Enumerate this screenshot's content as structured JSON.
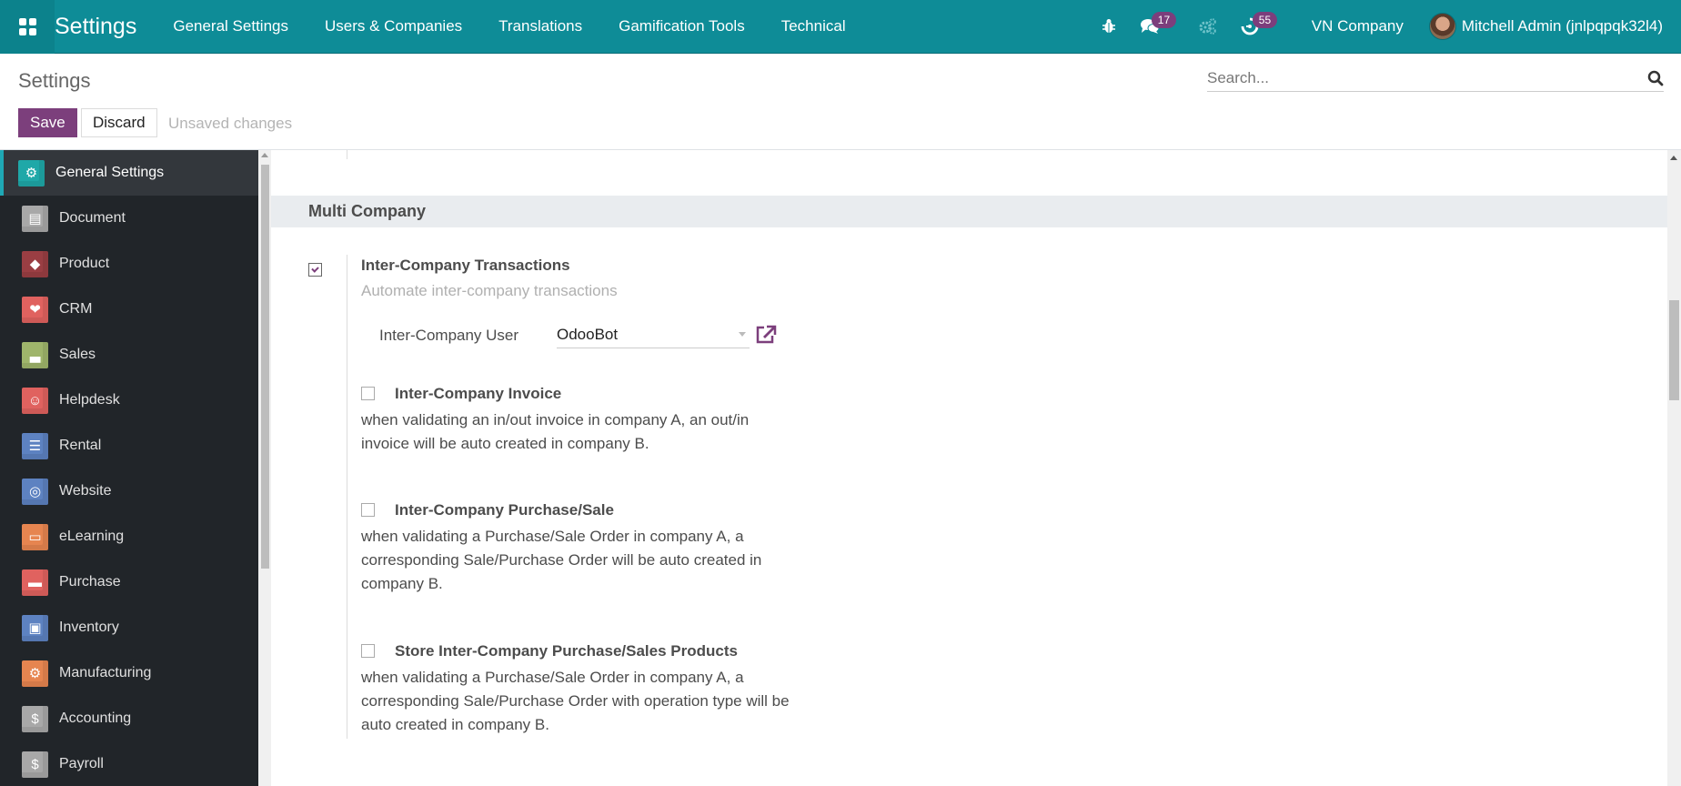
{
  "navbar": {
    "app_title": "Settings",
    "menu": [
      {
        "label": "General Settings"
      },
      {
        "label": "Users & Companies"
      },
      {
        "label": "Translations"
      },
      {
        "label": "Gamification Tools"
      },
      {
        "label": "Technical"
      }
    ],
    "icons": {
      "debug": "bug-icon",
      "messages": "chat-icon",
      "messages_count": "17",
      "settings": "gears-icon",
      "activities": "clock-icon",
      "activities_count": "55"
    },
    "company": "VN Company",
    "user": "Mitchell Admin (jnlpqpqk32l4)"
  },
  "control_panel": {
    "breadcrumb": "Settings",
    "search_placeholder": "Search...",
    "save_label": "Save",
    "discard_label": "Discard",
    "status": "Unsaved changes"
  },
  "sidebar": {
    "items": [
      {
        "label": "General Settings",
        "icon": "gear-icon",
        "color": "#1fa8a8",
        "active": true
      },
      {
        "label": "Document",
        "icon": "folder-icon",
        "color": "#a8a8a8"
      },
      {
        "label": "Product",
        "icon": "tag-icon",
        "color": "#9a3e43"
      },
      {
        "label": "CRM",
        "icon": "handshake-icon",
        "color": "#e0625f"
      },
      {
        "label": "Sales",
        "icon": "chart-icon",
        "color": "#9fb56b"
      },
      {
        "label": "Helpdesk",
        "icon": "support-icon",
        "color": "#e0625f"
      },
      {
        "label": "Rental",
        "icon": "list-icon",
        "color": "#5d82c1"
      },
      {
        "label": "Website",
        "icon": "globe-icon",
        "color": "#5d82c1"
      },
      {
        "label": "eLearning",
        "icon": "presentation-icon",
        "color": "#e68550"
      },
      {
        "label": "Purchase",
        "icon": "credit-card-icon",
        "color": "#e0625f"
      },
      {
        "label": "Inventory",
        "icon": "box-icon",
        "color": "#5d82c1"
      },
      {
        "label": "Manufacturing",
        "icon": "cog-wrench-icon",
        "color": "#e68550"
      },
      {
        "label": "Accounting",
        "icon": "invoice-icon",
        "color": "#a8a8a8"
      },
      {
        "label": "Payroll",
        "icon": "user-dollar-icon",
        "color": "#a8a8a8"
      }
    ]
  },
  "main": {
    "section_title": "Multi Company",
    "transactions": {
      "title": "Inter-Company Transactions",
      "subtitle": "Automate inter-company transactions",
      "checked": true,
      "user_label": "Inter-Company User",
      "user_value": "OdooBot"
    },
    "options": [
      {
        "title": "Inter-Company Invoice",
        "checked": false,
        "desc_lines": [
          "when validating an in/out invoice in company A, an out/in",
          "invoice will be auto created in company B."
        ]
      },
      {
        "title": "Inter-Company Purchase/Sale",
        "checked": false,
        "desc_lines": [
          "when validating a Purchase/Sale Order in company A, a",
          "corresponding Sale/Purchase Order will be auto created in",
          "company B."
        ]
      },
      {
        "title": "Store Inter-Company Purchase/Sales Products",
        "checked": false,
        "desc_lines": [
          "when validating a Purchase/Sale Order in company A, a",
          "corresponding Sale/Purchase Order with operation type will be",
          "auto created in company B."
        ]
      }
    ]
  }
}
